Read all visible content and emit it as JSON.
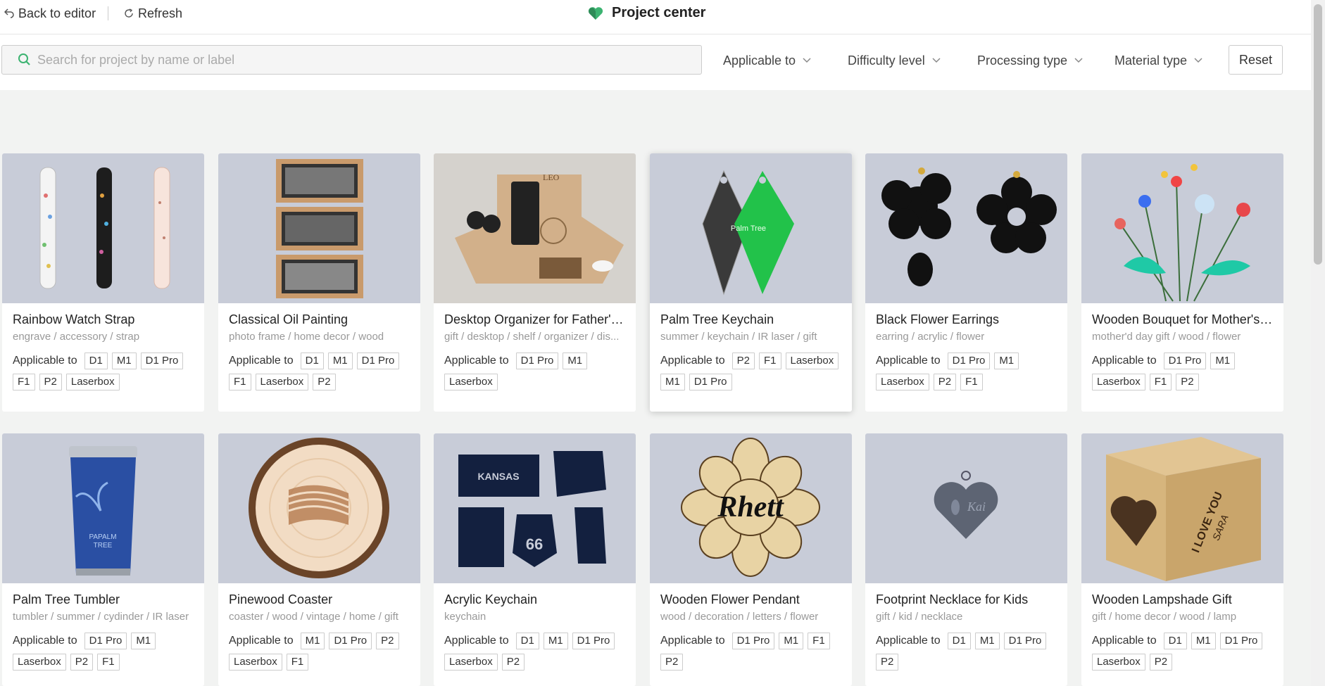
{
  "header": {
    "back_label": "Back to editor",
    "refresh_label": "Refresh",
    "title": "Project center",
    "accent": "#3cb371"
  },
  "filters": {
    "search_placeholder": "Search for project by name or label",
    "search_value": "",
    "applicable": "Applicable to",
    "difficulty": "Difficulty level",
    "processing": "Processing type",
    "material": "Material type",
    "reset": "Reset"
  },
  "applicable_label": "Applicable to",
  "projects": [
    {
      "name": "Rainbow Watch Strap",
      "tags": "engrave / accessory / strap",
      "devices": [
        "D1",
        "M1",
        "D1 Pro",
        "F1",
        "P2",
        "Laserbox"
      ],
      "image": "watch-straps"
    },
    {
      "name": "Classical Oil Painting",
      "tags": "photo frame / home decor / wood",
      "devices": [
        "D1",
        "M1",
        "D1 Pro",
        "F1",
        "Laserbox",
        "P2"
      ],
      "image": "framed-paintings"
    },
    {
      "name": "Desktop Organizer for Father's ...",
      "tags": "gift / desktop / shelf / organizer / dis...",
      "devices": [
        "D1 Pro",
        "M1",
        "Laserbox"
      ],
      "image": "desk-organizer"
    },
    {
      "name": "Palm Tree Keychain",
      "tags": "summer / keychain / IR laser / gift",
      "devices": [
        "P2",
        "F1",
        "Laserbox",
        "M1",
        "D1 Pro"
      ],
      "image": "palm-keychains"
    },
    {
      "name": "Black Flower Earrings",
      "tags": "earring / acrylic / flower",
      "devices": [
        "D1 Pro",
        "M1",
        "Laserbox",
        "P2",
        "F1"
      ],
      "image": "flower-earrings"
    },
    {
      "name": "Wooden Bouquet for Mother's ...",
      "tags": "mother'd day gift / wood / flower",
      "devices": [
        "D1 Pro",
        "M1",
        "Laserbox",
        "F1",
        "P2"
      ],
      "image": "bouquet"
    },
    {
      "name": "Palm Tree Tumbler",
      "tags": "tumbler / summer / cydinder / IR laser",
      "devices": [
        "D1 Pro",
        "M1",
        "Laserbox",
        "P2",
        "F1"
      ],
      "image": "tumbler"
    },
    {
      "name": "Pinewood Coaster",
      "tags": "coaster / wood / vintage / home / gift",
      "devices": [
        "M1",
        "D1 Pro",
        "P2",
        "Laserbox",
        "F1"
      ],
      "image": "coaster"
    },
    {
      "name": "Acrylic Keychain",
      "tags": "keychain",
      "devices": [
        "D1",
        "M1",
        "D1 Pro",
        "Laserbox",
        "P2"
      ],
      "image": "state-keychains"
    },
    {
      "name": "Wooden Flower Pendant",
      "tags": "wood / decoration / letters / flower",
      "devices": [
        "D1 Pro",
        "M1",
        "F1",
        "P2"
      ],
      "image": "flower-pendant"
    },
    {
      "name": "Footprint Necklace for Kids",
      "tags": "gift / kid / necklace",
      "devices": [
        "D1",
        "M1",
        "D1 Pro",
        "P2"
      ],
      "image": "heart-necklace"
    },
    {
      "name": "Wooden Lampshade Gift",
      "tags": "gift / home decor / wood / lamp",
      "devices": [
        "D1",
        "M1",
        "D1 Pro",
        "Laserbox",
        "P2"
      ],
      "image": "lampshade"
    }
  ],
  "image_text": {
    "pendant": "Rhett",
    "necklace": "Kai",
    "lamp": "I LOVE YOU",
    "lamp2": "SARA",
    "tumbler": "PAPALM",
    "tumbler2": "TREE",
    "route": "66",
    "kansas": "KANSAS",
    "keychain": "Palm Tree",
    "organizer": "LEO"
  }
}
